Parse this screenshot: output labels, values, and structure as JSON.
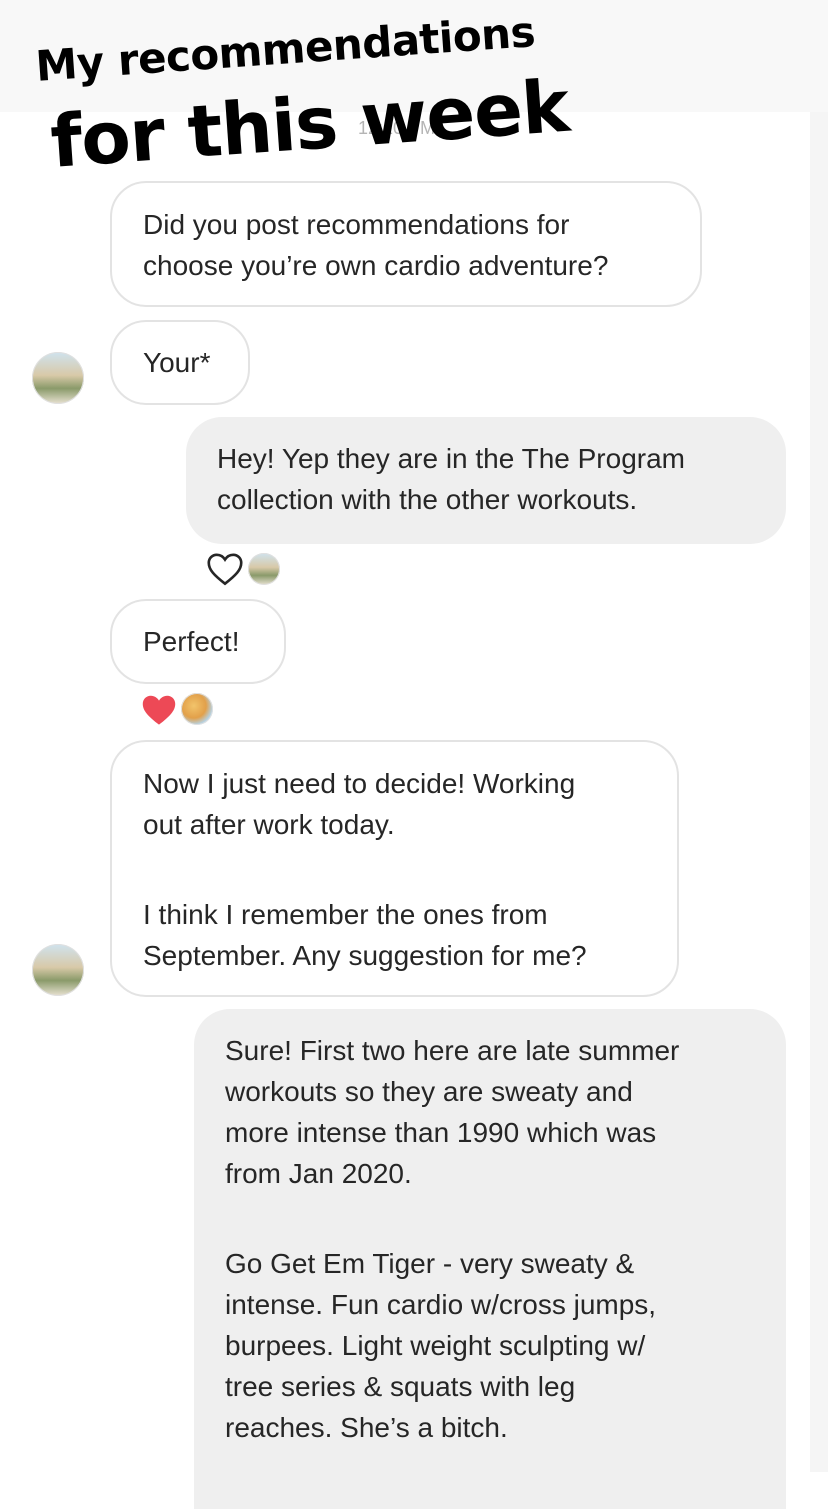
{
  "overlay": {
    "line1": "My recommendations",
    "line2": "for this week"
  },
  "thread": {
    "timestamp": "12:10 PM",
    "messages": [
      {
        "sender": "them",
        "text": "Did you post recommendations for\nchoose you’re own cardio adventure?"
      },
      {
        "sender": "them",
        "text": "Your*"
      },
      {
        "sender": "me",
        "text": "Hey! Yep they are in the The Program\ncollection with the other workouts."
      },
      {
        "sender": "them",
        "text": "Perfect!"
      },
      {
        "sender": "them",
        "paragraphs": [
          "Now I just need to decide! Working\nout after work today.",
          "I think I remember the ones from\nSeptember. Any suggestion for me?"
        ]
      },
      {
        "sender": "me",
        "paragraphs": [
          "Sure! First two here are late summer\nworkouts so they are sweaty and\nmore intense than 1990 which was\nfrom Jan 2020.",
          "Go Get Em Tiger - very sweaty &\nintense. Fun cardio w/cross jumps,\nburpees. Light weight sculpting w/\ntree series & squats with leg\nreaches. She’s a bitch."
        ]
      }
    ]
  },
  "colors": {
    "incoming_border": "#e3e3e3",
    "outgoing_bg": "#efefef",
    "heart_filled": "#ed4956",
    "text": "#262626"
  },
  "icons": {
    "reaction_1": "heart-outline-icon",
    "reaction_2": "heart-filled-icon"
  }
}
